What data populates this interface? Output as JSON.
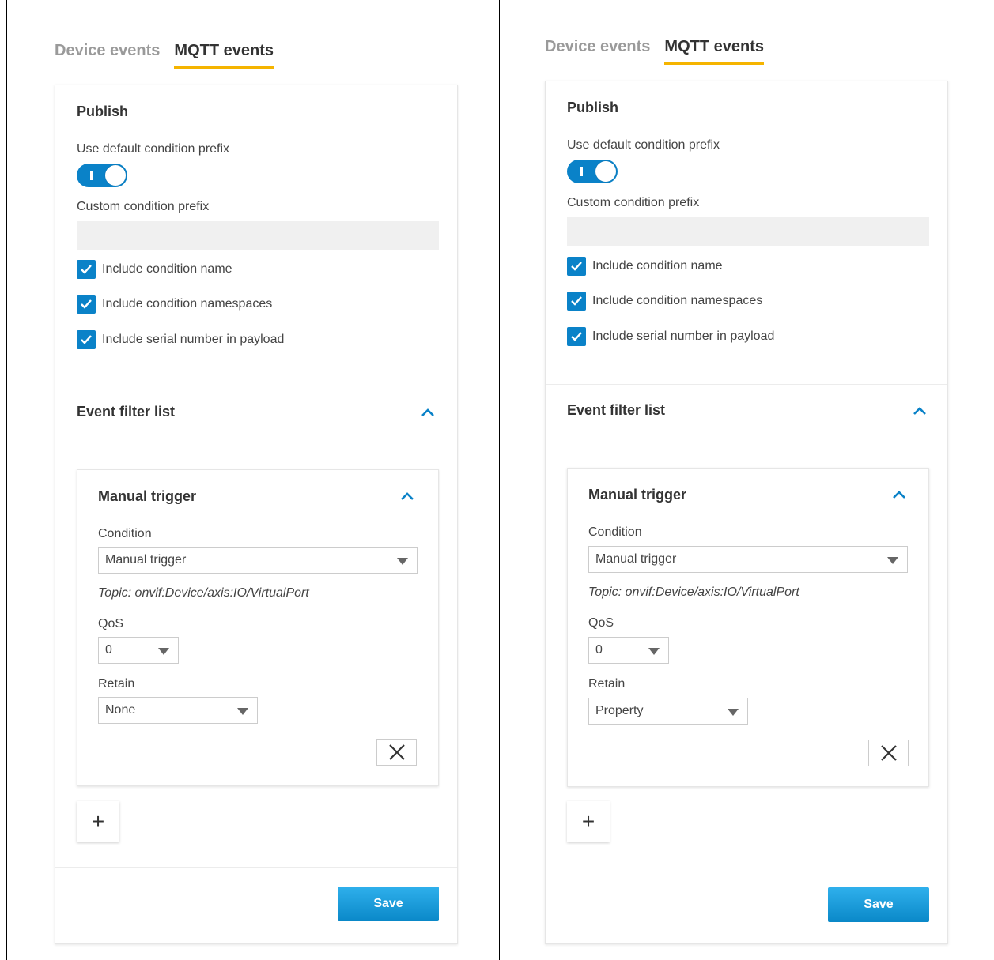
{
  "colors": {
    "accent": "#0a82c8",
    "tab_underline": "#f5b400"
  },
  "panels": [
    {
      "tabs": [
        "Device events",
        "MQTT events"
      ],
      "active_tab": "MQTT events",
      "publish": {
        "title": "Publish",
        "default_prefix_label": "Use default condition prefix",
        "default_prefix_on": true,
        "toggle_mark": "I",
        "custom_prefix_label": "Custom condition prefix",
        "custom_prefix_value": "",
        "checkboxes": [
          {
            "label": "Include condition name",
            "checked": true
          },
          {
            "label": "Include condition namespaces",
            "checked": true
          },
          {
            "label": "Include serial number in payload",
            "checked": true
          }
        ]
      },
      "filter_list": {
        "title": "Event filter list",
        "item": {
          "title": "Manual trigger",
          "condition_label": "Condition",
          "condition_value": "Manual trigger",
          "topic": "Topic: onvif:Device/axis:IO/VirtualPort",
          "qos_label": "QoS",
          "qos_value": "0",
          "retain_label": "Retain",
          "retain_value": "None"
        },
        "add_label": "+"
      },
      "save_label": "Save"
    },
    {
      "tabs": [
        "Device events",
        "MQTT events"
      ],
      "active_tab": "MQTT events",
      "publish": {
        "title": "Publish",
        "default_prefix_label": "Use default condition prefix",
        "default_prefix_on": true,
        "toggle_mark": "I",
        "custom_prefix_label": "Custom condition prefix",
        "custom_prefix_value": "",
        "checkboxes": [
          {
            "label": "Include condition name",
            "checked": true
          },
          {
            "label": "Include condition namespaces",
            "checked": true
          },
          {
            "label": "Include serial number in payload",
            "checked": true
          }
        ]
      },
      "filter_list": {
        "title": "Event filter list",
        "item": {
          "title": "Manual trigger",
          "condition_label": "Condition",
          "condition_value": "Manual trigger",
          "topic": "Topic: onvif:Device/axis:IO/VirtualPort",
          "qos_label": "QoS",
          "qos_value": "0",
          "retain_label": "Retain",
          "retain_value": "Property"
        },
        "add_label": "+"
      },
      "save_label": "Save"
    }
  ]
}
